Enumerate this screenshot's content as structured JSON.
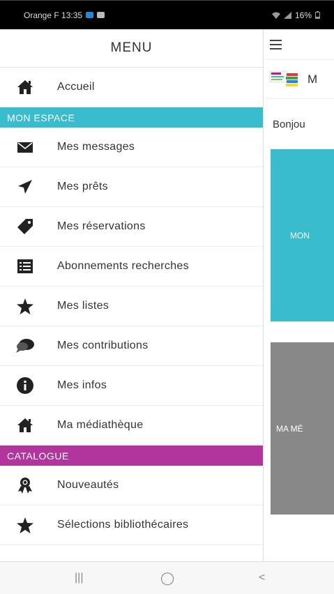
{
  "status_bar": {
    "carrier_time": "Orange F 13:35",
    "battery": "16%"
  },
  "drawer": {
    "title": "MENU",
    "home": {
      "label": "Accueil",
      "icon": "home-icon"
    },
    "section_espace": "MON ESPACE",
    "espace_items": [
      {
        "label": "Mes messages",
        "icon": "envelope-icon"
      },
      {
        "label": "Mes prêts",
        "icon": "paper-plane-icon"
      },
      {
        "label": "Mes réservations",
        "icon": "tag-icon"
      },
      {
        "label": "Abonnements recherches",
        "icon": "list-icon"
      },
      {
        "label": "Mes listes",
        "icon": "star-icon"
      },
      {
        "label": "Mes contributions",
        "icon": "comments-icon"
      },
      {
        "label": "Mes infos",
        "icon": "info-icon"
      },
      {
        "label": "Ma médiathèque",
        "icon": "home-icon"
      }
    ],
    "section_catalogue": "CATALOGUE",
    "catalogue_items": [
      {
        "label": "Nouveautés",
        "icon": "award-icon"
      },
      {
        "label": "Sélections bibliothécaires",
        "icon": "star-icon"
      }
    ]
  },
  "background_page": {
    "logo_letter": "M",
    "greeting": "Bonjou",
    "tile1": "MON",
    "tile2": "MA MÉ"
  },
  "nav_bar": {
    "recents": "|||",
    "home": "◯",
    "back": "<"
  },
  "colors": {
    "espace": "#39bccd",
    "catalogue": "#b2359e",
    "grey_tile": "#888888"
  }
}
